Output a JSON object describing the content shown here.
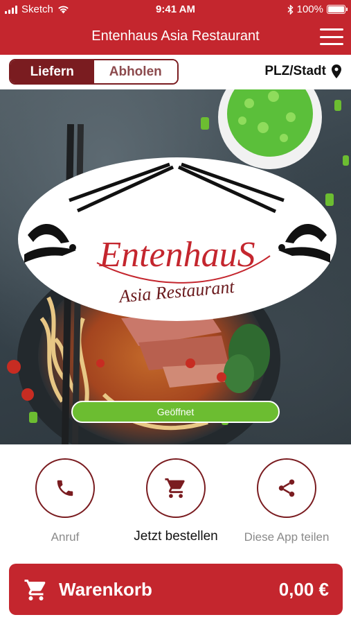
{
  "status_bar": {
    "carrier": "Sketch",
    "time": "9:41 AM",
    "battery": "100%"
  },
  "header": {
    "title": "Entenhaus Asia Restaurant",
    "menu_icon": "hamburger-menu-icon"
  },
  "mode": {
    "options": [
      "Liefern",
      "Abholen"
    ],
    "selected": "Liefern",
    "location_label": "PLZ/Stadt",
    "location_icon": "map-pin-icon"
  },
  "hero": {
    "logo_name": "EntenhauS",
    "logo_subtitle": "Asia Restaurant",
    "status_badge": "Geöffnet"
  },
  "actions": [
    {
      "label": "Anruf",
      "icon": "phone-icon"
    },
    {
      "label": "Jetzt bestellen",
      "icon": "cart-icon"
    },
    {
      "label": "Diese App teilen",
      "icon": "share-icon"
    }
  ],
  "cart": {
    "label": "Warenkorb",
    "total": "0,00 €",
    "icon": "cart-icon"
  },
  "colors": {
    "brand_red": "#c4262e",
    "dark_red": "#7a1c20",
    "open_green": "#6cbd31"
  }
}
